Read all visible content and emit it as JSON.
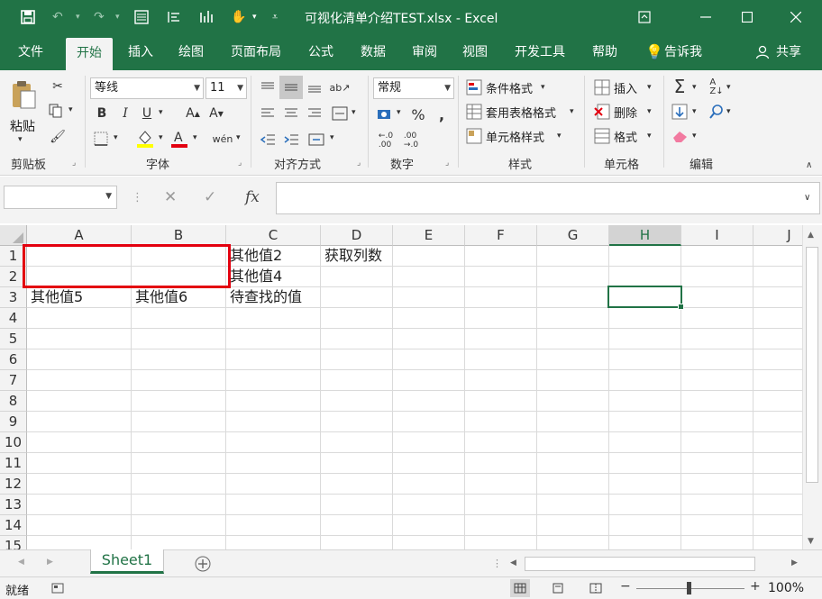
{
  "window": {
    "title": "可视化清单介绍TEST.xlsx  -  Excel",
    "accent": "#217346"
  },
  "ribbon_tabs": [
    "文件",
    "开始",
    "插入",
    "绘图",
    "页面布局",
    "公式",
    "数据",
    "审阅",
    "视图",
    "开发工具",
    "帮助",
    "告诉我",
    "共享"
  ],
  "ribbon": {
    "clipboard": {
      "paste": "粘贴",
      "label": "剪贴板"
    },
    "font": {
      "name": "等线",
      "size": "11",
      "label": "字体"
    },
    "alignment": {
      "label": "对齐方式"
    },
    "number": {
      "format": "常规",
      "label": "数字"
    },
    "styles": {
      "conditional": "条件格式",
      "table": "套用表格格式",
      "cell": "单元格样式",
      "label": "样式"
    },
    "cells": {
      "insert": "插入",
      "delete": "删除",
      "format": "格式",
      "label": "单元格"
    },
    "editing": {
      "label": "编辑"
    }
  },
  "formula_bar": {
    "name_box": "",
    "formula": "",
    "fx": "fx"
  },
  "columns": [
    "A",
    "B",
    "C",
    "D",
    "E",
    "F",
    "G",
    "H",
    "I",
    "J"
  ],
  "selected_column": "H",
  "rows": [
    "1",
    "2",
    "3",
    "4",
    "5",
    "6",
    "7",
    "8",
    "9",
    "10",
    "11",
    "12",
    "13",
    "14",
    "15"
  ],
  "cells": {
    "C1": "其他值2",
    "D1": "获取列数",
    "C2": "其他值4",
    "A3": "其他值5",
    "B3": "其他值6",
    "C3": "待查找的值"
  },
  "highlight_color": "#e3000f",
  "sheet_tabs": [
    "Sheet1"
  ],
  "status": {
    "ready": "就绪",
    "zoom": "100%"
  }
}
